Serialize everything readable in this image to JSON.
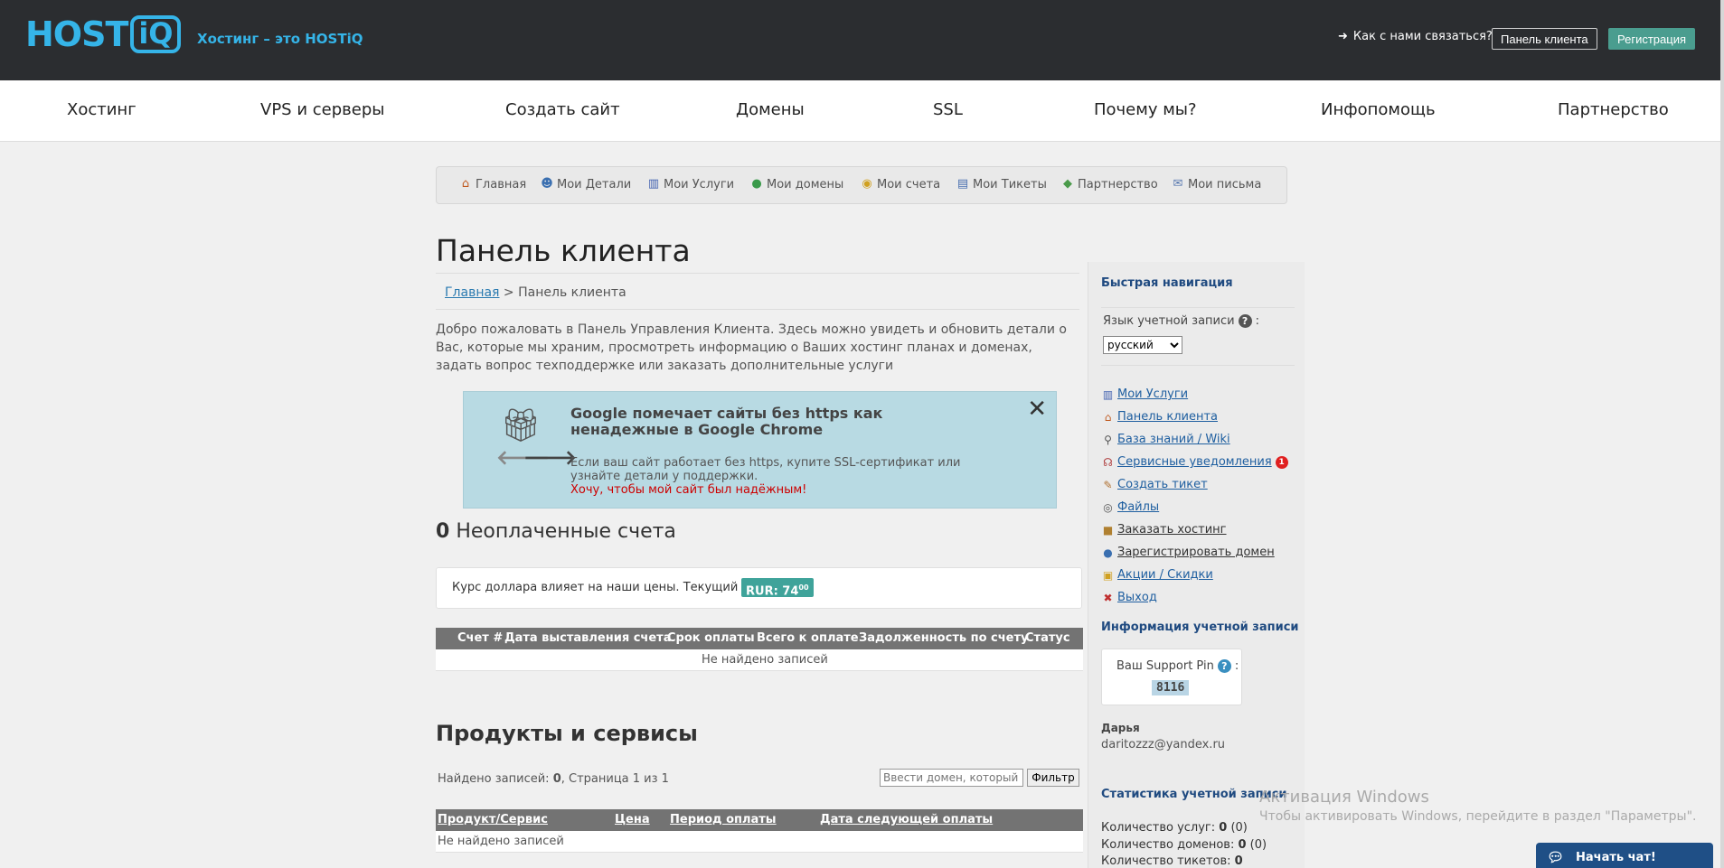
{
  "header": {
    "logo_host": "HOST",
    "logo_iq": "iQ",
    "tagline": "Хостинг – это HOSTiQ",
    "contact": "Как с нами связаться?",
    "client_panel_btn": "Панель клиента",
    "register_btn": "Регистрация"
  },
  "main_nav": [
    "Хостинг",
    "VPS и серверы",
    "Создать сайт",
    "Домены",
    "SSL",
    "Почему мы?",
    "Инфопомощь",
    "Партнерство"
  ],
  "client_nav": [
    {
      "label": "Главная",
      "icon": "home-icon"
    },
    {
      "label": "Мои Детали",
      "icon": "user-icon"
    },
    {
      "label": "Мои Услуги",
      "icon": "chart-icon"
    },
    {
      "label": "Мои домены",
      "icon": "globe-icon"
    },
    {
      "label": "Мои счета",
      "icon": "coins-icon"
    },
    {
      "label": "Мои Тикеты",
      "icon": "ticket-icon"
    },
    {
      "label": "Партнерство",
      "icon": "tag-icon"
    },
    {
      "label": "Мои письма",
      "icon": "mail-icon"
    }
  ],
  "page": {
    "title": "Панель клиента",
    "breadcrumb_home": "Главная",
    "breadcrumb_sep": " > ",
    "breadcrumb_current": "Панель клиента",
    "welcome": "Добро пожаловать в Панель Управления Клиента. Здесь можно увидеть и обновить детали о Вас, которые мы храним, просмотреть информацию о Ваших хостинг планах и доменах, задать вопрос техподдержке или заказать дополнительные услуги"
  },
  "promo": {
    "title": "Google помечает сайты без https как ненадежные в Google Chrome",
    "text": "Если ваш сайт работает без https, купите SSL-сертификат или узнайте детали у поддержки.",
    "link": "Хочу, чтобы мой сайт был надёжным!",
    "close": "✕"
  },
  "unpaid": {
    "count": "0",
    "label": "Неоплаченные счета"
  },
  "rate": {
    "text": "Курс доллара влияет на наши цены. Текущий курс:",
    "badge": "RUR: 74",
    "badge_sup": "00"
  },
  "invoices_table": {
    "headers": [
      "Счет #",
      "Дата выставления счета",
      "Срок оплаты",
      "Всего к оплате",
      "Задолженность по счету",
      "Статус"
    ],
    "empty": "Не найдено записей"
  },
  "products": {
    "title": "Продукты и сервисы",
    "found_prefix": "Найдено записей: ",
    "found_count": "0",
    "found_suffix": ", Страница 1 из 1",
    "filter_placeholder": "Ввести домен, который нуж",
    "filter_btn": "Фильтр",
    "headers": [
      "Продукт/Сервис",
      "Цена",
      "Период оплаты",
      "Дата следующей оплаты"
    ],
    "empty": "Не найдено записей"
  },
  "sidebar": {
    "quick_nav_title": "Быстрая навигация",
    "lang_label": "Язык учетной записи",
    "lang_colon": ":",
    "lang_selected": "русский",
    "links": [
      {
        "label": "Мои Услуги",
        "icon": "chart-icon"
      },
      {
        "label": "Панель клиента",
        "icon": "home-icon"
      },
      {
        "label": "База знаний / Wiki",
        "icon": "search-icon"
      },
      {
        "label": "Сервисные уведомления",
        "icon": "antenna-icon",
        "badge": "1"
      },
      {
        "label": "Создать тикет",
        "icon": "pencil-icon"
      },
      {
        "label": "Файлы",
        "icon": "disc-icon"
      },
      {
        "label": "Заказать хостинг",
        "icon": "box-icon"
      },
      {
        "label": "Зарегистрировать домен",
        "icon": "globe-icon"
      },
      {
        "label": "Акции / Скидки",
        "icon": "gift-icon"
      },
      {
        "label": "Выход",
        "icon": "exit-icon"
      }
    ],
    "account_info_title": "Информация учетной записи",
    "support_pin_label": "Ваш Support Pin",
    "support_pin": "8116",
    "user_name": "Дарья",
    "user_email": "daritozzz@yandex.ru",
    "stats_title": "Статистика учетной записи",
    "stats": [
      {
        "label": "Количество услуг: ",
        "value": "0",
        "extra": " (0)"
      },
      {
        "label": "Количество доменов: ",
        "value": "0",
        "extra": " (0)"
      },
      {
        "label": "Количество тикетов: ",
        "value": "0",
        "extra": ""
      }
    ]
  },
  "watermark": {
    "title": "Активация Windows",
    "subtitle": "Чтобы активировать Windows, перейдите в раздел \"Параметры\"."
  },
  "chat": {
    "label": "Начать чат!"
  },
  "colors": {
    "header_bg": "#2b2d30",
    "brand_blue": "#35b4e8",
    "accent_green": "#4a9d8f",
    "promo_bg": "#b8dae3"
  }
}
